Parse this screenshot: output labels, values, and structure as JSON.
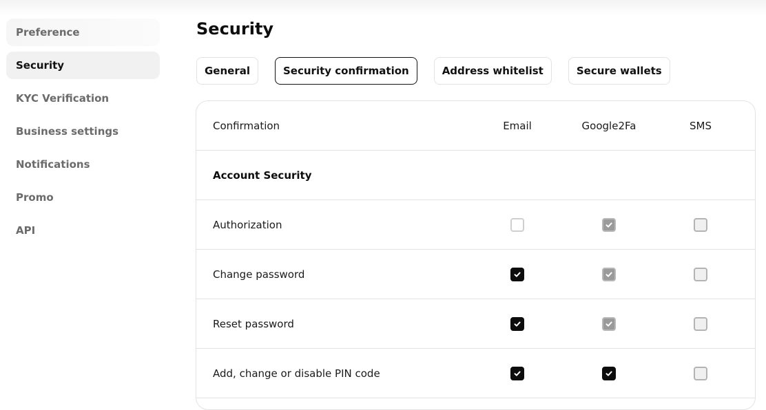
{
  "sidebar": {
    "items": [
      {
        "label": "Preference"
      },
      {
        "label": "Security"
      },
      {
        "label": "KYC Verification"
      },
      {
        "label": "Business settings"
      },
      {
        "label": "Notifications"
      },
      {
        "label": "Promo"
      },
      {
        "label": "API"
      }
    ]
  },
  "page": {
    "title": "Security"
  },
  "tabs": [
    {
      "label": "General"
    },
    {
      "label": "Security confirmation"
    },
    {
      "label": "Address whitelist"
    },
    {
      "label": "Secure wallets"
    }
  ],
  "table": {
    "headers": {
      "confirmation": "Confirmation",
      "email": "Email",
      "google2fa": "Google2Fa",
      "sms": "SMS"
    },
    "section": "Account Security",
    "rows": [
      {
        "label": "Authorization",
        "email": "unchecked",
        "google2fa": "disabled-checked",
        "sms": "disabled-unchecked"
      },
      {
        "label": "Change password",
        "email": "checked",
        "google2fa": "disabled-checked",
        "sms": "disabled-unchecked"
      },
      {
        "label": "Reset password",
        "email": "checked",
        "google2fa": "disabled-checked",
        "sms": "disabled-unchecked"
      },
      {
        "label": "Add, change or disable PIN code",
        "email": "checked",
        "google2fa": "checked",
        "sms": "disabled-unchecked"
      }
    ]
  },
  "icons": {
    "checkbox_check": "checkmark-icon"
  },
  "colors": {
    "accent": "#0d0d0d",
    "border": "#e3e3e3",
    "muted_text": "#6b6b6b",
    "active_bg": "#f1f1f1"
  }
}
